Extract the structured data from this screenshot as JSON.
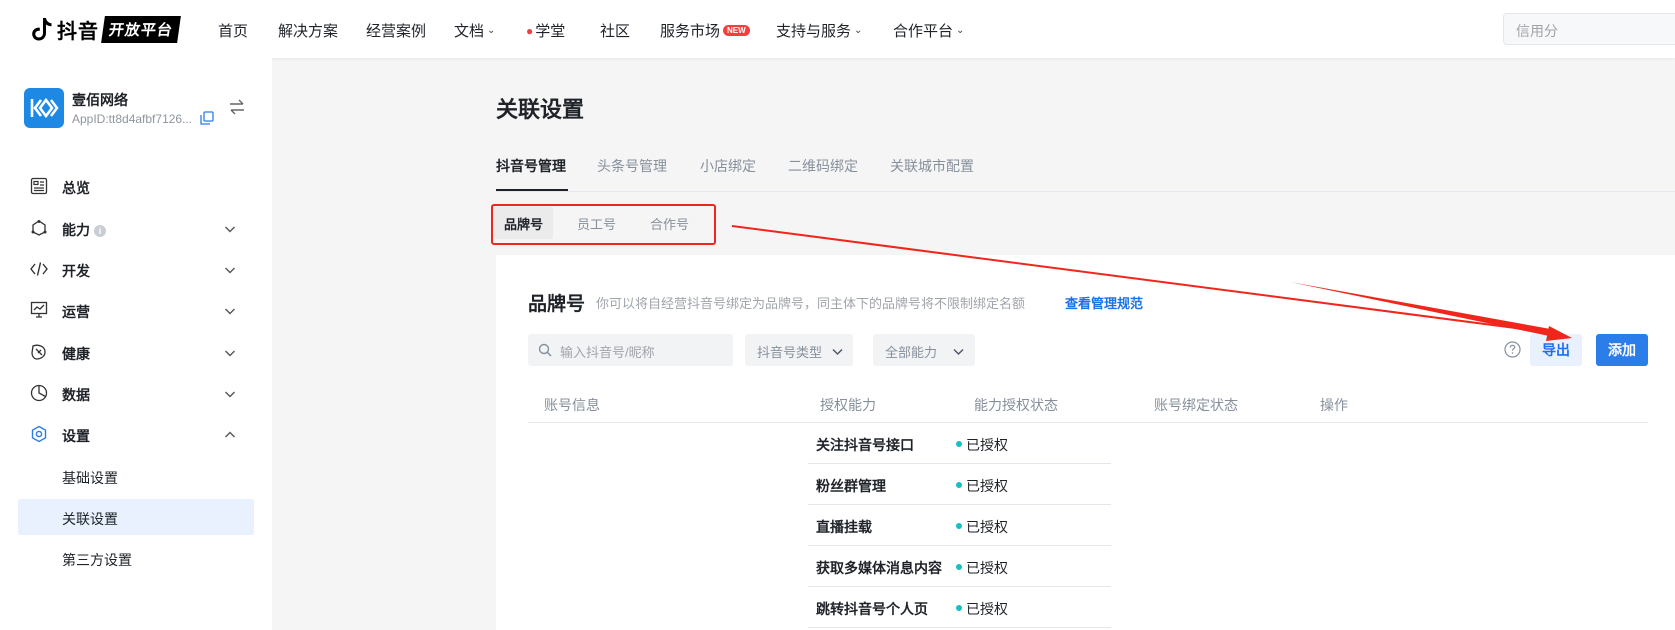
{
  "topnav": {
    "logo_text": "抖音",
    "logo_badge": "开放平台",
    "items": [
      {
        "label": "首页"
      },
      {
        "label": "解决方案"
      },
      {
        "label": "经营案例"
      },
      {
        "label": "文档"
      },
      {
        "label": "学堂"
      },
      {
        "label": "社区"
      },
      {
        "label": "服务市场",
        "badge": "NEW"
      },
      {
        "label": "支持与服务"
      },
      {
        "label": "合作平台"
      }
    ],
    "credit_placeholder": "信用分"
  },
  "sidebar": {
    "app_name": "壹佰网络",
    "app_id": "AppID:tt8d4afbf7126...",
    "items": [
      {
        "label": "总览",
        "icon": "dashboard-icon"
      },
      {
        "label": "能力",
        "icon": "capability-icon"
      },
      {
        "label": "开发",
        "icon": "code-icon"
      },
      {
        "label": "运营",
        "icon": "operations-icon"
      },
      {
        "label": "健康",
        "icon": "health-icon"
      },
      {
        "label": "数据",
        "icon": "pie-chart-icon"
      },
      {
        "label": "设置",
        "icon": "settings-icon"
      }
    ],
    "settings_children": [
      {
        "label": "基础设置"
      },
      {
        "label": "关联设置",
        "active": true
      },
      {
        "label": "第三方设置"
      }
    ]
  },
  "main": {
    "title": "关联设置",
    "tabs": [
      {
        "label": "抖音号管理",
        "active": true
      },
      {
        "label": "头条号管理"
      },
      {
        "label": "小店绑定"
      },
      {
        "label": "二维码绑定"
      },
      {
        "label": "关联城市配置"
      }
    ],
    "subtabs": [
      {
        "label": "品牌号",
        "active": true
      },
      {
        "label": "员工号"
      },
      {
        "label": "合作号"
      }
    ],
    "panel": {
      "title": "品牌号",
      "description": "你可以将自经营抖音号绑定为品牌号，同主体下的品牌号将不限制绑定名额",
      "link": "查看管理规范",
      "search_placeholder": "输入抖音号/昵称",
      "filter_type": "抖音号类型",
      "filter_capability": "全部能力",
      "export_label": "导出",
      "add_label": "添加",
      "columns": [
        "账号信息",
        "授权能力",
        "能力授权状态",
        "账号绑定状态",
        "操作"
      ],
      "rows": [
        {
          "capability": "关注抖音号接口",
          "status": "已授权"
        },
        {
          "capability": "粉丝群管理",
          "status": "已授权"
        },
        {
          "capability": "直播挂载",
          "status": "已授权"
        },
        {
          "capability": "获取多媒体消息内容",
          "status": "已授权"
        },
        {
          "capability": "跳转抖音号个人页",
          "status": "已授权"
        }
      ]
    }
  },
  "colors": {
    "accent": "#2b7de9",
    "annotation": "#f0261c",
    "status_dot": "#14c0c4"
  }
}
